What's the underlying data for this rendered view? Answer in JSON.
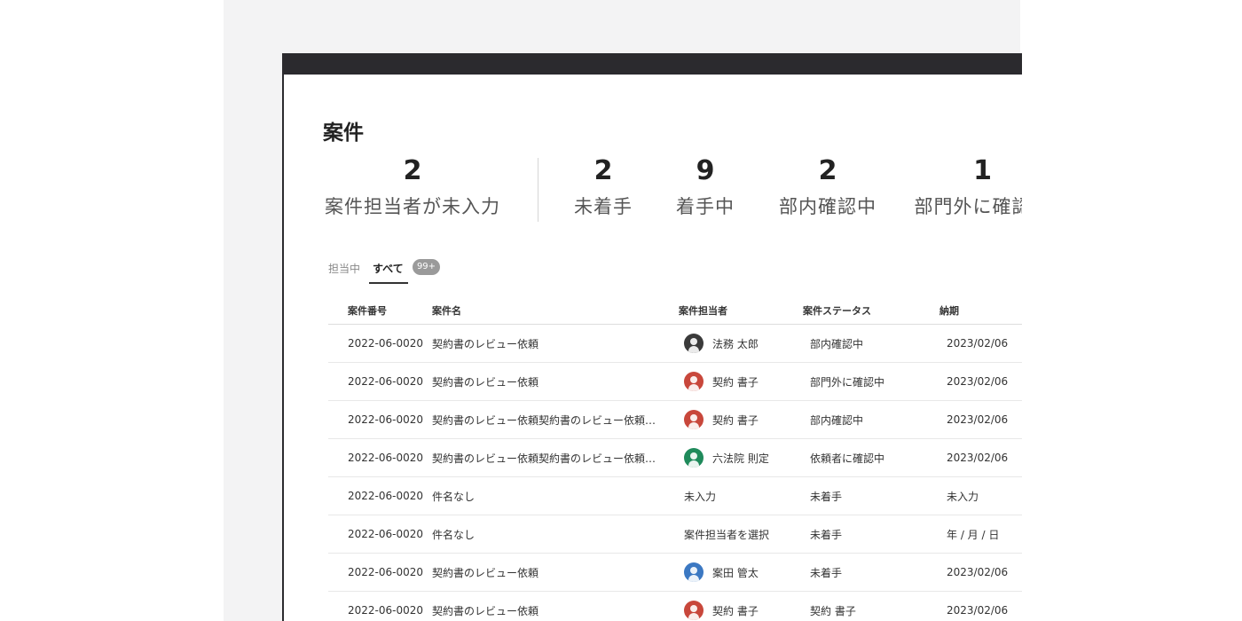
{
  "page": {
    "title": "案件"
  },
  "stats": [
    {
      "value": "2",
      "label": "案件担当者が未入力"
    },
    {
      "value": "2",
      "label": "未着手"
    },
    {
      "value": "9",
      "label": "着手中"
    },
    {
      "value": "2",
      "label": "部内確認中"
    },
    {
      "value": "1",
      "label": "部門外に確認中"
    }
  ],
  "tabs": {
    "assigned": "担当中",
    "all": "すべて",
    "all_count": "99+"
  },
  "table": {
    "headers": {
      "number": "案件番号",
      "name": "案件名",
      "owner": "案件担当者",
      "status": "案件ステータス",
      "due": "納期"
    },
    "rows": [
      {
        "number": "2022-06-0020",
        "name": "契約書のレビュー依頼",
        "owner": "法務 太郎",
        "avatar_color": "#3a3a3a",
        "status": "部内確認中",
        "due": "2023/02/06"
      },
      {
        "number": "2022-06-0020",
        "name": "契約書のレビュー依頼",
        "owner": "契約 書子",
        "avatar_color": "#c8473b",
        "status": "部門外に確認中",
        "due": "2023/02/06"
      },
      {
        "number": "2022-06-0020",
        "name": "契約書のレビュー依頼契約書のレビュー依頼契約書のレビュー依頼",
        "owner": "契約 書子",
        "avatar_color": "#c8473b",
        "status": "部内確認中",
        "due": "2023/02/06"
      },
      {
        "number": "2022-06-0020",
        "name": "契約書のレビュー依頼契約書のレビュー依頼契約書のレビュー依頼",
        "owner": "六法院 則定",
        "avatar_color": "#1f8a5b",
        "status": "依頼者に確認中",
        "due": "2023/02/06"
      },
      {
        "number": "2022-06-0020",
        "name": "件名なし",
        "owner": "未入力",
        "avatar_color": "",
        "status": "未着手",
        "due": "未入力"
      },
      {
        "number": "2022-06-0020",
        "name": "件名なし",
        "owner": "案件担当者を選択",
        "avatar_color": "",
        "status": "未着手",
        "due": "年 / 月 / 日"
      },
      {
        "number": "2022-06-0020",
        "name": "契約書のレビュー依頼",
        "owner": "案田 管太",
        "avatar_color": "#3b78c2",
        "status": "未着手",
        "due": "2023/02/06"
      },
      {
        "number": "2022-06-0020",
        "name": "契約書のレビュー依頼",
        "owner": "契約 書子",
        "avatar_color": "#c8473b",
        "status": "契約 書子",
        "due": "2023/02/06"
      }
    ]
  }
}
